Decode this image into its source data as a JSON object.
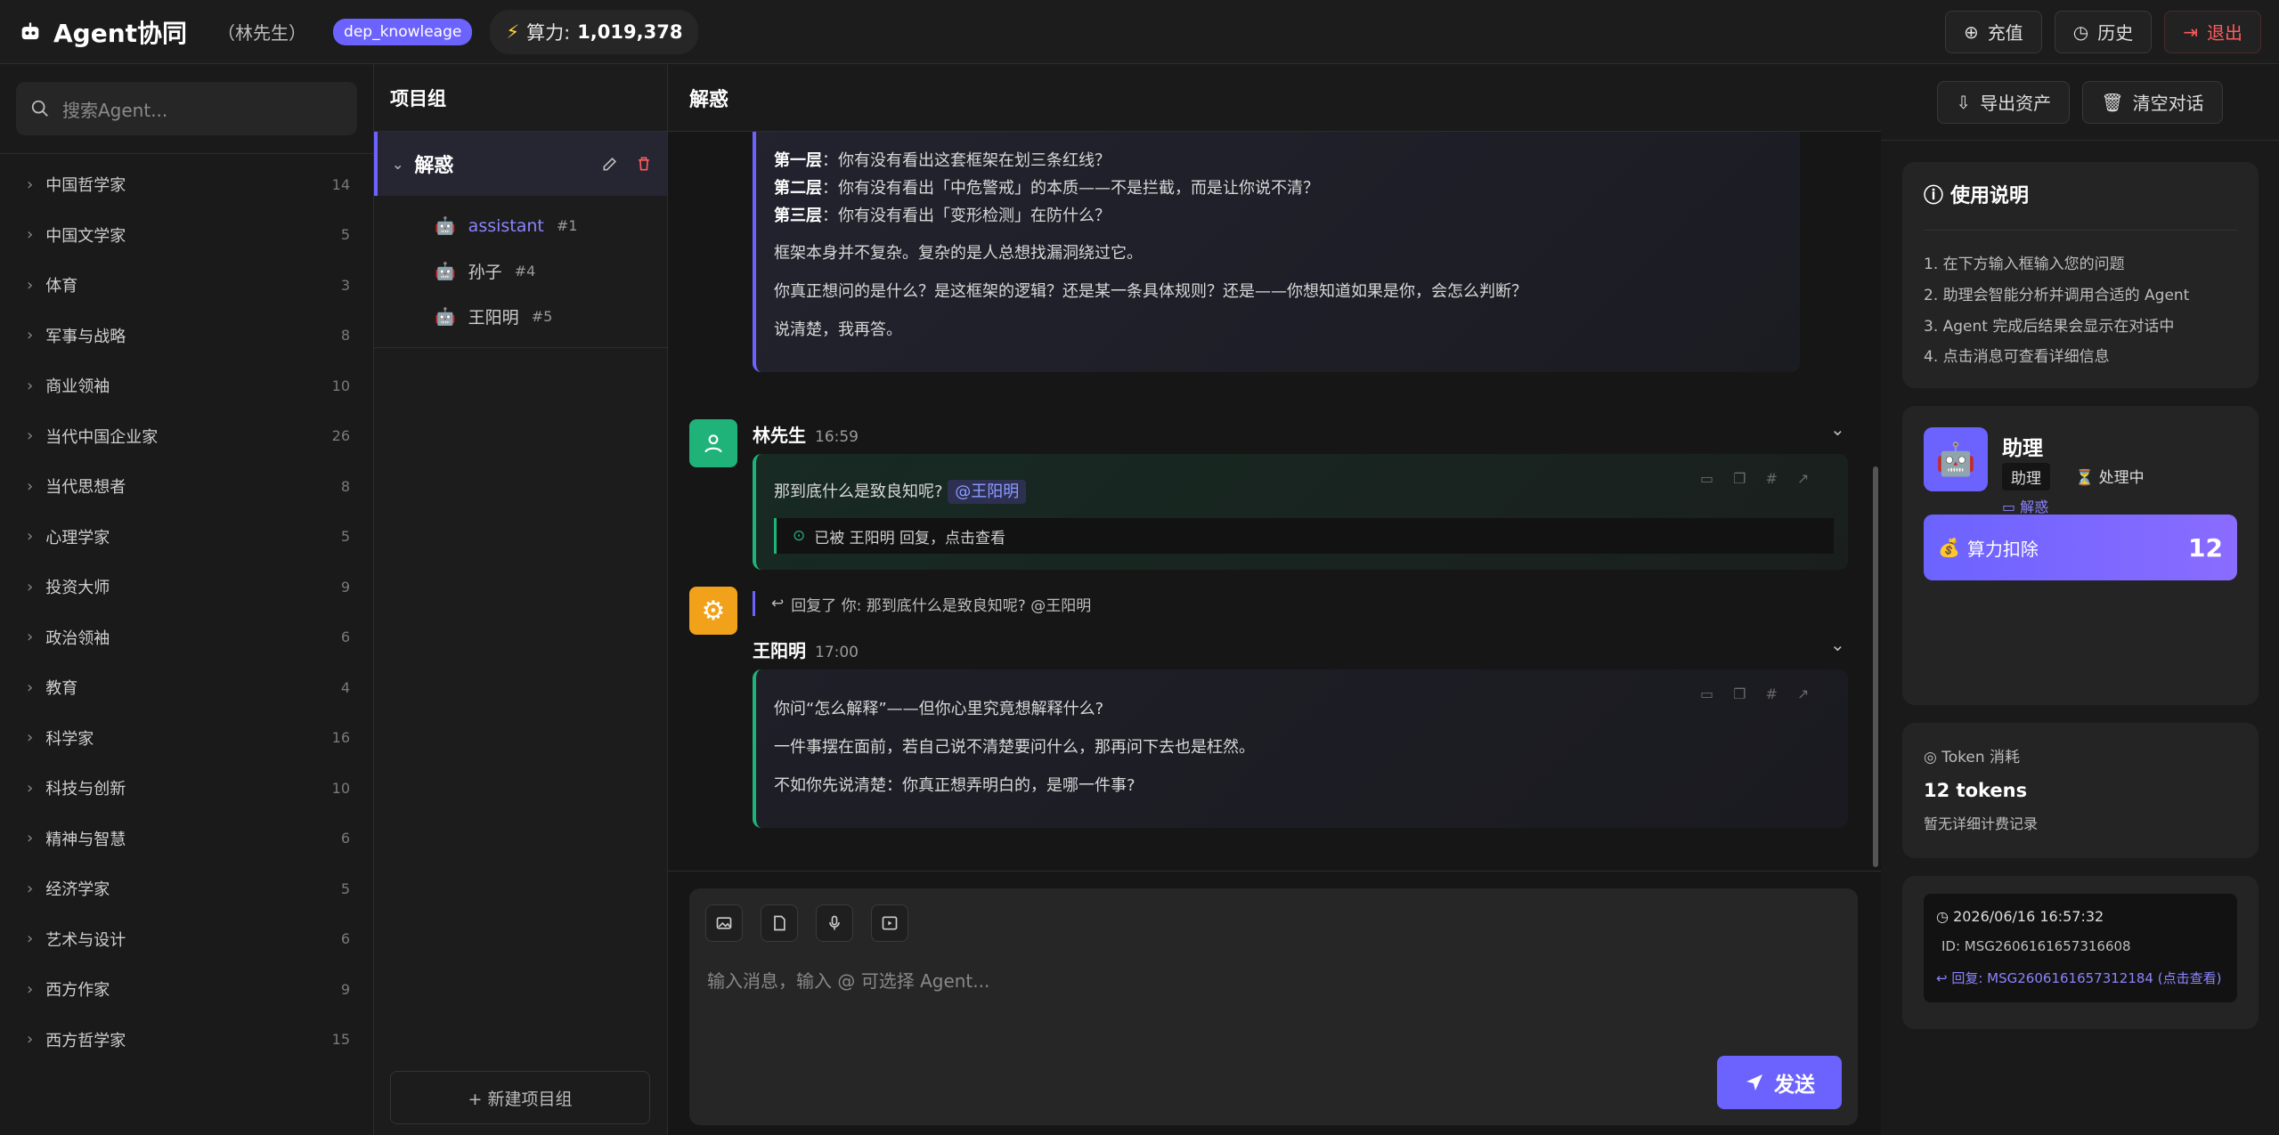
{
  "app": {
    "title": "Agent协同",
    "user": "（林先生）",
    "badge": "dep_knowleage",
    "power_label": "算力:",
    "power_value": "1,019,378"
  },
  "top_actions": {
    "recharge": "充值",
    "history": "历史",
    "logout": "退出"
  },
  "sidebar": {
    "search_placeholder": "搜索Agent...",
    "categories": [
      {
        "label": "中国哲学家",
        "count": "14"
      },
      {
        "label": "中国文学家",
        "count": "5"
      },
      {
        "label": "体育",
        "count": "3"
      },
      {
        "label": "军事与战略",
        "count": "8"
      },
      {
        "label": "商业领袖",
        "count": "10"
      },
      {
        "label": "当代中国企业家",
        "count": "26"
      },
      {
        "label": "当代思想者",
        "count": "8"
      },
      {
        "label": "心理学家",
        "count": "5"
      },
      {
        "label": "投资大师",
        "count": "9"
      },
      {
        "label": "政治领袖",
        "count": "6"
      },
      {
        "label": "教育",
        "count": "4"
      },
      {
        "label": "科学家",
        "count": "16"
      },
      {
        "label": "科技与创新",
        "count": "10"
      },
      {
        "label": "精神与智慧",
        "count": "6"
      },
      {
        "label": "经济学家",
        "count": "5"
      },
      {
        "label": "艺术与设计",
        "count": "6"
      },
      {
        "label": "西方作家",
        "count": "9"
      },
      {
        "label": "西方哲学家",
        "count": "15"
      }
    ]
  },
  "projects": {
    "header": "项目组",
    "group_name": "解惑",
    "agents": [
      {
        "name": "assistant",
        "num": "#1"
      },
      {
        "name": "孙子",
        "num": "#4"
      },
      {
        "name": "王阳明",
        "num": "#5"
      }
    ],
    "new_group": "+ 新建项目组"
  },
  "chat": {
    "title": "解惑",
    "msg1": {
      "l1_b": "第一层",
      "l1": "：你有没有看出这套框架在划三条红线？",
      "l2_b": "第二层",
      "l2": "：你有没有看出「中危警戒」的本质——不是拦截，而是让你说不清？",
      "l3_b": "第三层",
      "l3": "：你有没有看出「变形检测」在防什么？",
      "p1": "框架本身并不复杂。复杂的是人总想找漏洞绕过它。",
      "p2": "你真正想问的是什么？是这框架的逻辑？还是某一条具体规则？还是——你想知道如果是你，会怎么判断？",
      "p3": "说清楚，我再答。"
    },
    "msg2": {
      "name": "林先生",
      "time": "16:59",
      "text": "那到底什么是致良知呢?",
      "mention": "@王阳明",
      "reply_note": "已被 王阳明 回复，点击查看"
    },
    "msg3": {
      "quote": "回复了 你: 那到底什么是致良知呢? @王阳明",
      "name": "王阳明",
      "time": "17:00",
      "p1": "你问“怎么解释”——但你心里究竟想解释什么?",
      "p2": "一件事摆在面前，若自己说不清楚要问什么，那再问下去也是枉然。",
      "p3": "不如你先说清楚：你真正想弄明白的，是哪一件事?"
    },
    "input_placeholder": "输入消息，输入 @ 可选择 Agent...",
    "send": "发送"
  },
  "right": {
    "export": "导出资产",
    "clear": "清空对话",
    "usage_title": "使用说明",
    "steps": [
      "1. 在下方输入框输入您的问题",
      "2. 助理会智能分析并调用合适的 Agent",
      "3. Agent 完成后结果会显示在对话中",
      "4. 点击消息可查看详细信息"
    ],
    "agent_name": "助理",
    "agent_tag": "助理",
    "agent_status": "处理中",
    "agent_group": "解惑",
    "cost_label": "算力扣除",
    "cost_value": "12",
    "token_title": "Token 消耗",
    "tokens": "12 tokens",
    "token_note": "暂无详细计费记录",
    "meta_time": "2026/06/16 16:57:32",
    "meta_id": "ID: MSG2606161657316608",
    "meta_reply": "回复: MSG2606161657312184 (点击查看)"
  }
}
